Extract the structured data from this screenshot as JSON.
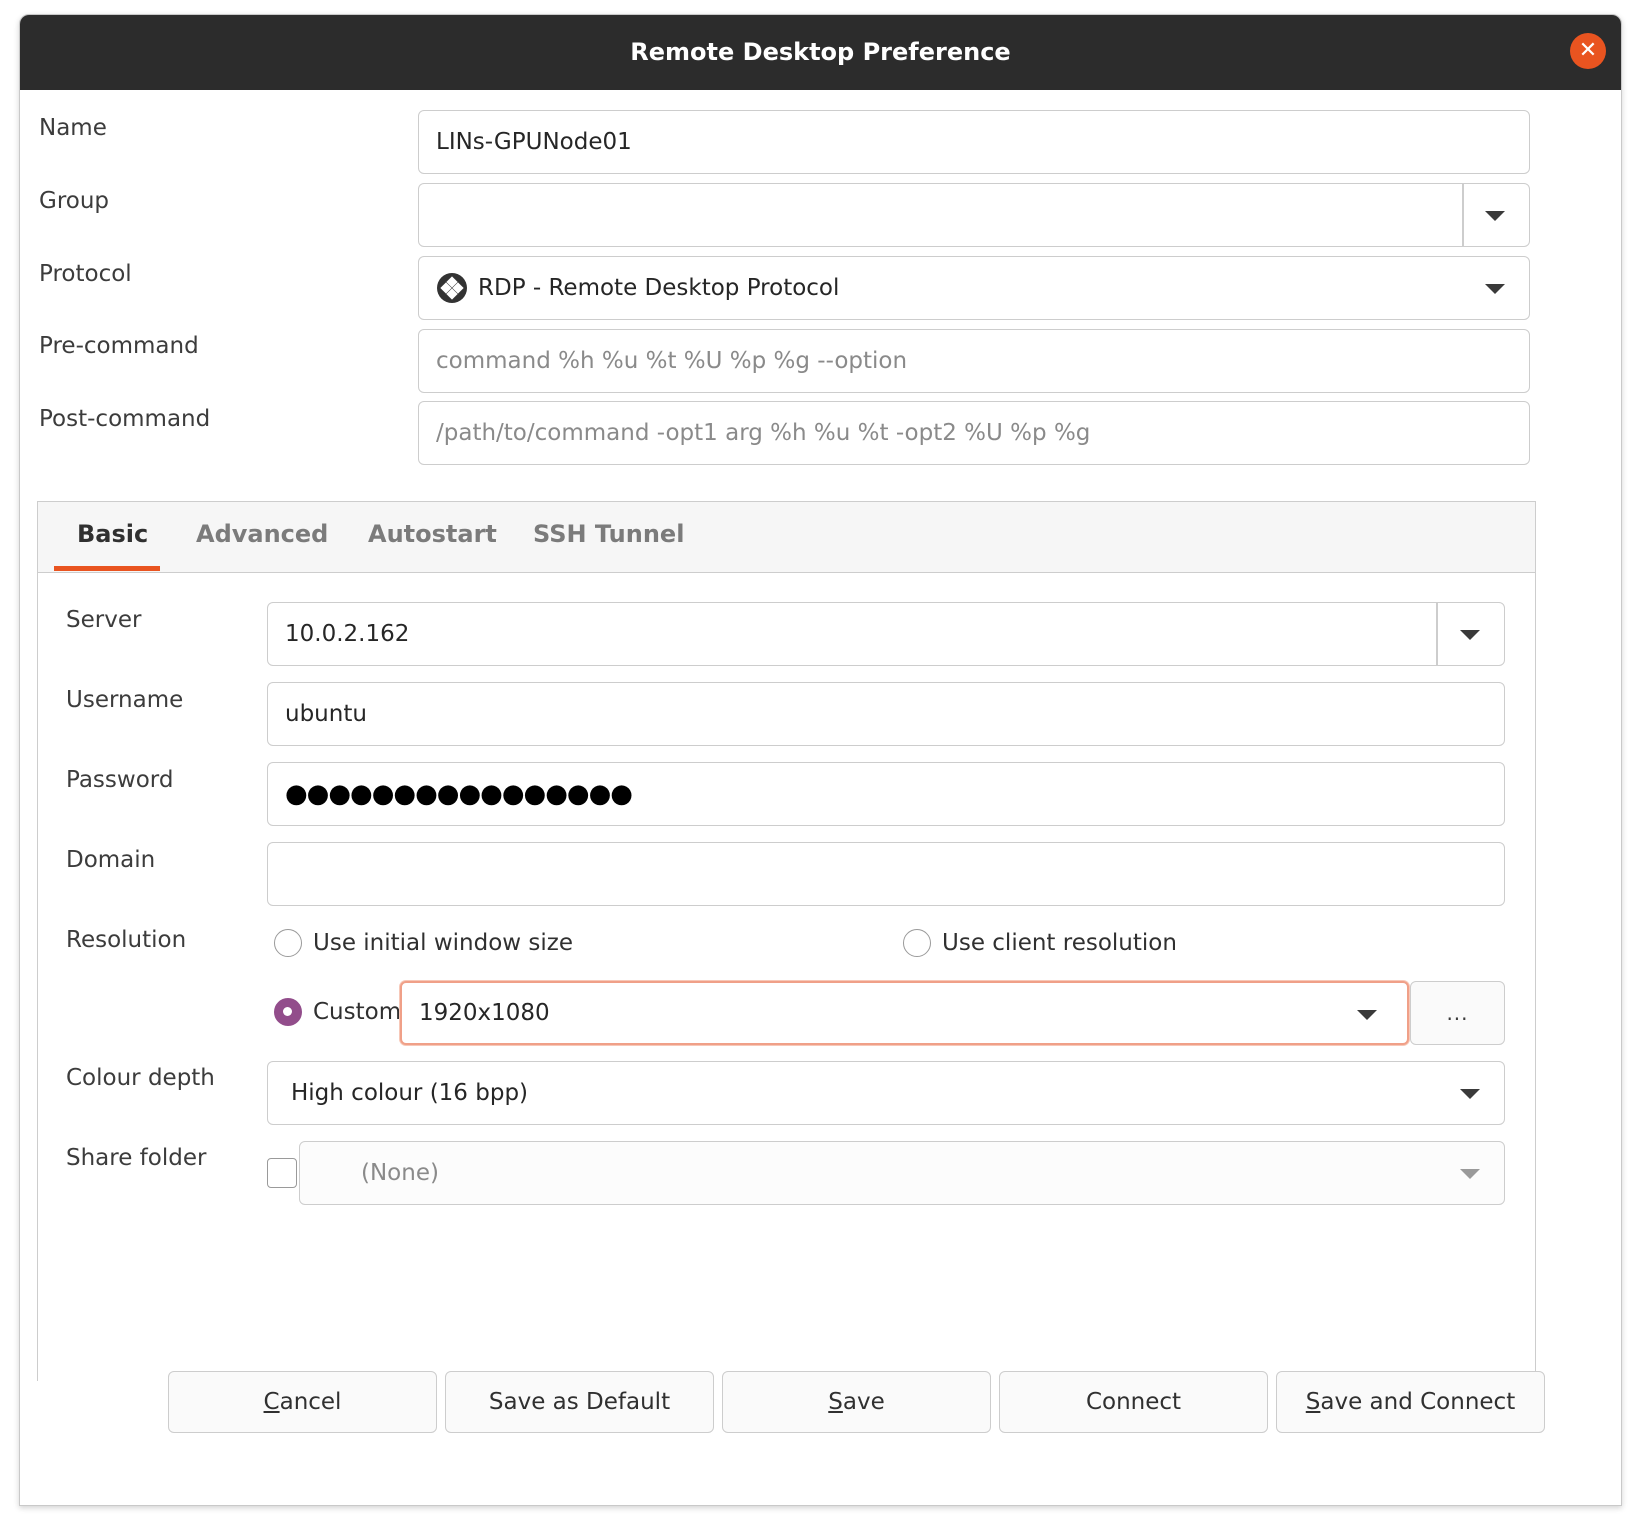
{
  "window": {
    "title": "Remote Desktop Preference",
    "close_icon": "close-icon",
    "accent": "#e95420"
  },
  "form": {
    "name_label": "Name",
    "name_value": "LINs-GPUNode01",
    "group_label": "Group",
    "group_value": "",
    "protocol_label": "Protocol",
    "protocol_value": "RDP - Remote Desktop Protocol",
    "protocol_icon": "rdp-plugin-icon",
    "precommand_label": "Pre-command",
    "precommand_placeholder": "command %h %u %t %U %p %g --option",
    "postcommand_label": "Post-command",
    "postcommand_placeholder": "/path/to/command -opt1 arg %h %u %t -opt2 %U %p %g"
  },
  "tabs": [
    {
      "label": "Basic",
      "active": true
    },
    {
      "label": "Advanced",
      "active": false
    },
    {
      "label": "Autostart",
      "active": false
    },
    {
      "label": "SSH Tunnel",
      "active": false
    }
  ],
  "basic": {
    "server_label": "Server",
    "server_value": "10.0.2.162",
    "username_label": "Username",
    "username_value": "ubuntu",
    "password_label": "Password",
    "password_value": "●●●●●●●●●●●●●●●●",
    "domain_label": "Domain",
    "domain_value": "",
    "resolution_label": "Resolution",
    "resolution_options": {
      "initial": "Use initial window size",
      "client": "Use client resolution",
      "custom": "Custom"
    },
    "resolution_selected": "custom",
    "resolution_value": "1920x1080",
    "resolution_more": "...",
    "colour_depth_label": "Colour depth",
    "colour_depth_value": "High colour (16 bpp)",
    "share_folder_label": "Share folder",
    "share_folder_checked": false,
    "share_folder_value": "(None)"
  },
  "buttons": {
    "cancel": {
      "mnemonic": "C",
      "rest": "ancel"
    },
    "save_default": "Save as Default",
    "save": {
      "mnemonic": "S",
      "rest": "ave"
    },
    "connect": "Connect",
    "save_connect": {
      "mnemonic": "S",
      "rest": "ave and Connect"
    }
  }
}
